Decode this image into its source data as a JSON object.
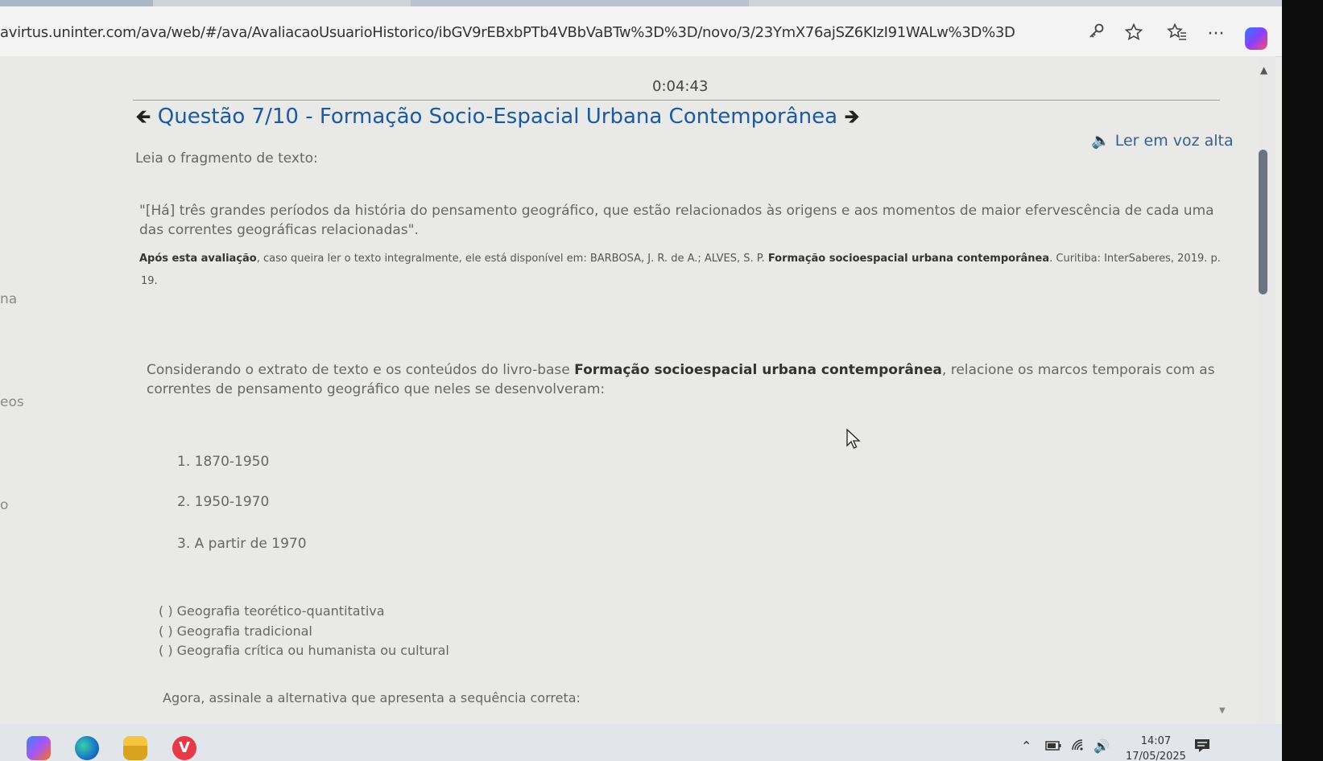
{
  "browser": {
    "url": "avirtus.uninter.com/ava/web/#/ava/AvaliacaoUsuarioHistorico/ibGV9rEBxbPTb4VBbVaBTw%3D%3D/novo/3/23YmX76ajSZ6KIzI91WALw%3D%3D",
    "icons": [
      "key-icon",
      "star-icon",
      "favorites-icon",
      "more-icon",
      "copilot-icon"
    ]
  },
  "page": {
    "timer": "0:04:43",
    "title": "Questão 7/10 - Formação Socio-Espacial Urbana Contemporânea",
    "read_aloud": "Ler em voz alta",
    "intro": "Leia o fragmento de texto:",
    "quote_line1": "\"[Há] três grandes períodos da história do pensamento geográfico, que estão relacionados às origens e aos momentos de maior efervescência de cada uma",
    "quote_line2": "das correntes geográficas relacionadas\".",
    "ref_bold1": "Após esta avaliação",
    "ref_text1": ", caso queira ler o texto integralmente, ele está disponível em: BARBOSA, J. R. de A.; ALVES, S. P. ",
    "ref_bold2": "Formação socioespacial urbana contemporânea",
    "ref_text2": ". Curitiba: InterSaberes, 2019. p.",
    "ref_line2": "19.",
    "cons_text1": "Considerando o extrato de texto e os conteúdos do livro-base ",
    "cons_bold": "Formação socioespacial urbana contemporânea",
    "cons_text2": ", relacione os marcos temporais com as",
    "cons_line2": "correntes de pensamento geográfico que neles se desenvolveram:",
    "items": [
      "1. 1870-1950",
      "2. 1950-1970",
      "3. A partir de 1970"
    ],
    "options": [
      "( ) Geografia teorético-quantitativa",
      "( ) Geografia tradicional",
      "( ) Geografia crítica ou humanista ou cultural"
    ],
    "final": "Agora, assinale a alternativa que apresenta a sequência correta:",
    "edge_fragments": [
      "na",
      "eos",
      "o"
    ]
  },
  "taskbar": {
    "apps": [
      "copilot-icon",
      "edge-icon",
      "file-explorer-icon",
      "vivaldi-icon"
    ],
    "time": "14:07",
    "date": "17/05/2025"
  }
}
